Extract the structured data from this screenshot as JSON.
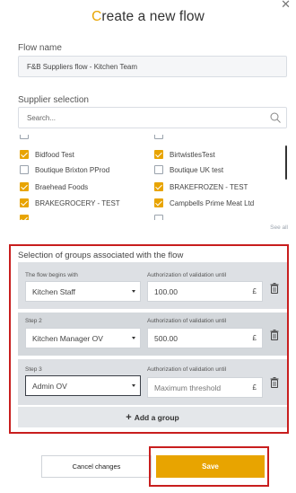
{
  "modal": {
    "close_icon": "close-icon",
    "title_first_letter": "C",
    "title_rest": "reate a new flow"
  },
  "flow_name": {
    "label": "Flow name",
    "value": "F&B Suppliers flow - Kitchen Team"
  },
  "supplier_selection": {
    "label": "Supplier selection",
    "search_placeholder": "Search...",
    "see_all": "See all",
    "items": [
      {
        "label": "Bidfood Test",
        "checked": true
      },
      {
        "label": "BirtwistlesTest",
        "checked": true
      },
      {
        "label": "Boutique Brixton PProd",
        "checked": false
      },
      {
        "label": "Boutique UK test",
        "checked": false
      },
      {
        "label": "Braehead Foods",
        "checked": true
      },
      {
        "label": "BRAKEFROZEN - TEST",
        "checked": true
      },
      {
        "label": "BRAKEGROCERY - TEST",
        "checked": true
      },
      {
        "label": "Campbells Prime Meat Ltd",
        "checked": true
      }
    ]
  },
  "groups": {
    "title": "Selection of groups associated with the flow",
    "authorization_label": "Authorization of validation until",
    "currency": "£",
    "steps": [
      {
        "label": "The flow begins with",
        "group": "Kitchen Staff",
        "amount": "100.00",
        "amount_placeholder": ""
      },
      {
        "label": "Step 2",
        "group": "Kitchen Manager OV",
        "amount": "500.00",
        "amount_placeholder": ""
      },
      {
        "label": "Step 3",
        "group": "Admin OV",
        "amount": "",
        "amount_placeholder": "Maximum threshold"
      }
    ],
    "add_group_label": "Add a group"
  },
  "actions": {
    "cancel_label": "Cancel changes",
    "save_label": "Save"
  },
  "colors": {
    "accent": "#e8a400",
    "highlight_border": "#c81e1e"
  }
}
